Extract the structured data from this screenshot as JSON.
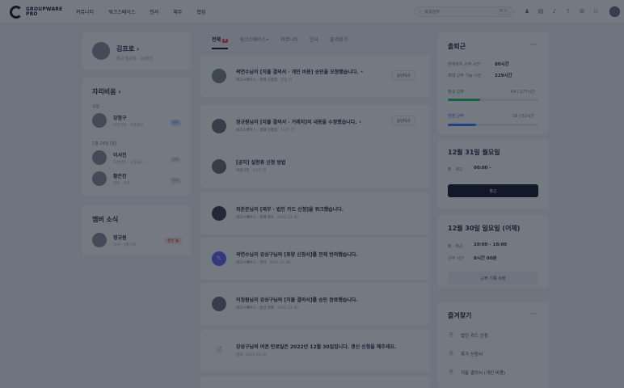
{
  "brand": {
    "line1": "GROUPWARE",
    "line2": "PRO"
  },
  "nav": [
    "커뮤니티",
    "워크스페이스",
    "인사",
    "재무",
    "협업"
  ],
  "search": {
    "placeholder": "통합검색",
    "shortcut": "⌘ K"
  },
  "profile": {
    "name": "김프로",
    "sub": "최근 접속일 · 10분전"
  },
  "absence": {
    "title": "자리비움",
    "today_label": "오늘",
    "today": [
      {
        "name": "강정구",
        "sub": "오전반차 · 오후출근",
        "tag": "반차"
      }
    ],
    "date_label": "1월 24일 (일)",
    "upcoming": [
      {
        "name": "이서진",
        "sub": "오전반차 · 오후출근",
        "tag": "반차"
      },
      {
        "name": "황은진",
        "sub": "연차 · 하루",
        "tag": "연차"
      }
    ]
  },
  "member_news": {
    "title": "멤버 소식",
    "items": [
      {
        "name": "정규원",
        "sub": "입사 · 1월 1일",
        "tag": "생일 🎉"
      }
    ]
  },
  "tabs": [
    {
      "label": "전체",
      "badge": "8"
    },
    {
      "label": "워크스페이스",
      "dot": "•"
    },
    {
      "label": "커뮤니티"
    },
    {
      "label": "인사"
    },
    {
      "label": "즐겨찾기"
    }
  ],
  "feed": [
    {
      "title": "곽연수님이 [지출 결의서 · 개인 비용] 승인을 요청했습니다.",
      "meta": "워크스페이스 · 결재 신청함",
      "time": "방금 전",
      "action": "승인하기",
      "unread": "•"
    },
    {
      "title": "정규원님이 [지출 결의서 · 거래처]의 내용을 수정했습니다.",
      "meta": "워크스페이스 · 결재 신청함",
      "time": "1시간 전",
      "action": "승인하기",
      "unread": "•"
    },
    {
      "title": "[공지] 설현휴 신청 방법",
      "meta": "커뮤니티",
      "time": "1시간 전"
    },
    {
      "title": "최준준님이 [재무 · 법인 카드 신청]을 워크했습니다.",
      "meta": "워크스페이스 · 결재 취소",
      "time": "2021.12.30"
    },
    {
      "title": "곽연수님이 강상구님의 [휴양 신청서]를 전체 반려했습니다.",
      "meta": "워크스페이스 · 전자",
      "time": "2021.12.30",
      "initials": "TL"
    },
    {
      "title": "이정원님이 강상구님의 [지출 결의서]를 승인 완료했습니다.",
      "meta": "워크스페이스 · 승인 완료",
      "time": "2021.12.30"
    },
    {
      "title": "강상구님의 여권 만료일은 2022년 12월 30일입니다. 갱신 신청을 해주세요.",
      "meta": "인사",
      "time": "2021.12.30"
    }
  ],
  "attendance": {
    "title": "출퇴근",
    "week_label": "현재까지 근무 시간",
    "week_value": "80시간",
    "max_label": "최대 근무 가능 시간",
    "max_value": "229시간",
    "regular_label": "정규 근무",
    "regular_value": "64 / 177시간",
    "regular_fraction": 0.36,
    "overtime_label": "연장 근무",
    "overtime_value": "16 / 52시간",
    "overtime_fraction": 0.31,
    "green": "#22c55e",
    "blue": "#3b82f6"
  },
  "today_card": {
    "date": "12월 31일 월요일",
    "inout_label": "출 · 퇴근",
    "inout_value": "00:00 -",
    "button": "출근"
  },
  "yesterday_card": {
    "date": "12월 30일 일요일 (어제)",
    "inout_label": "출 · 퇴근",
    "inout_value": "10:00 - 18:00",
    "work_label": "근무 시간",
    "work_value": "8시간 00분",
    "button": "근무 기록 수정"
  },
  "favorites": {
    "title": "즐겨찾기",
    "items": [
      "법인 카드 신청",
      "휴가 신청서",
      "지출 결의서 (개인 비용)"
    ]
  }
}
